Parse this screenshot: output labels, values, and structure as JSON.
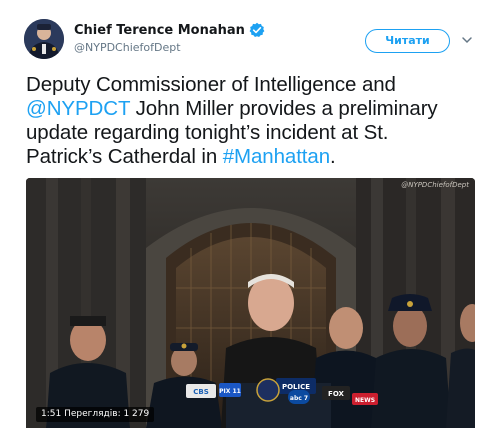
{
  "account": {
    "display_name": "Chief Terence Monahan",
    "handle": "@NYPDChiefofDept",
    "avatar_icon": "profile-avatar",
    "verified_icon": "verified-badge-icon"
  },
  "actions": {
    "follow_label": "Читати",
    "menu_icon": "chevron-down-icon"
  },
  "tweet": {
    "text_part1": "Deputy Commissioner of Intelligence and ",
    "mention": "@NYPDCT",
    "text_part2": " John Miller provides a preliminary update regarding tonight’s incident at St. Patrick’s Catherdal in ",
    "hashtag": "#Manhattan",
    "text_part3": "."
  },
  "video": {
    "watermark": "@NYPDChiefofDept",
    "duration": "1:51",
    "views": "Переглядів: 1 279",
    "podium_sign": "POLICE",
    "mic_labels": [
      "CBS",
      "PIX 11",
      "FOX",
      "abc 7",
      "NEWS"
    ]
  },
  "colors": {
    "link": "#1da1f2",
    "text": "#14171a",
    "muted": "#657786"
  }
}
